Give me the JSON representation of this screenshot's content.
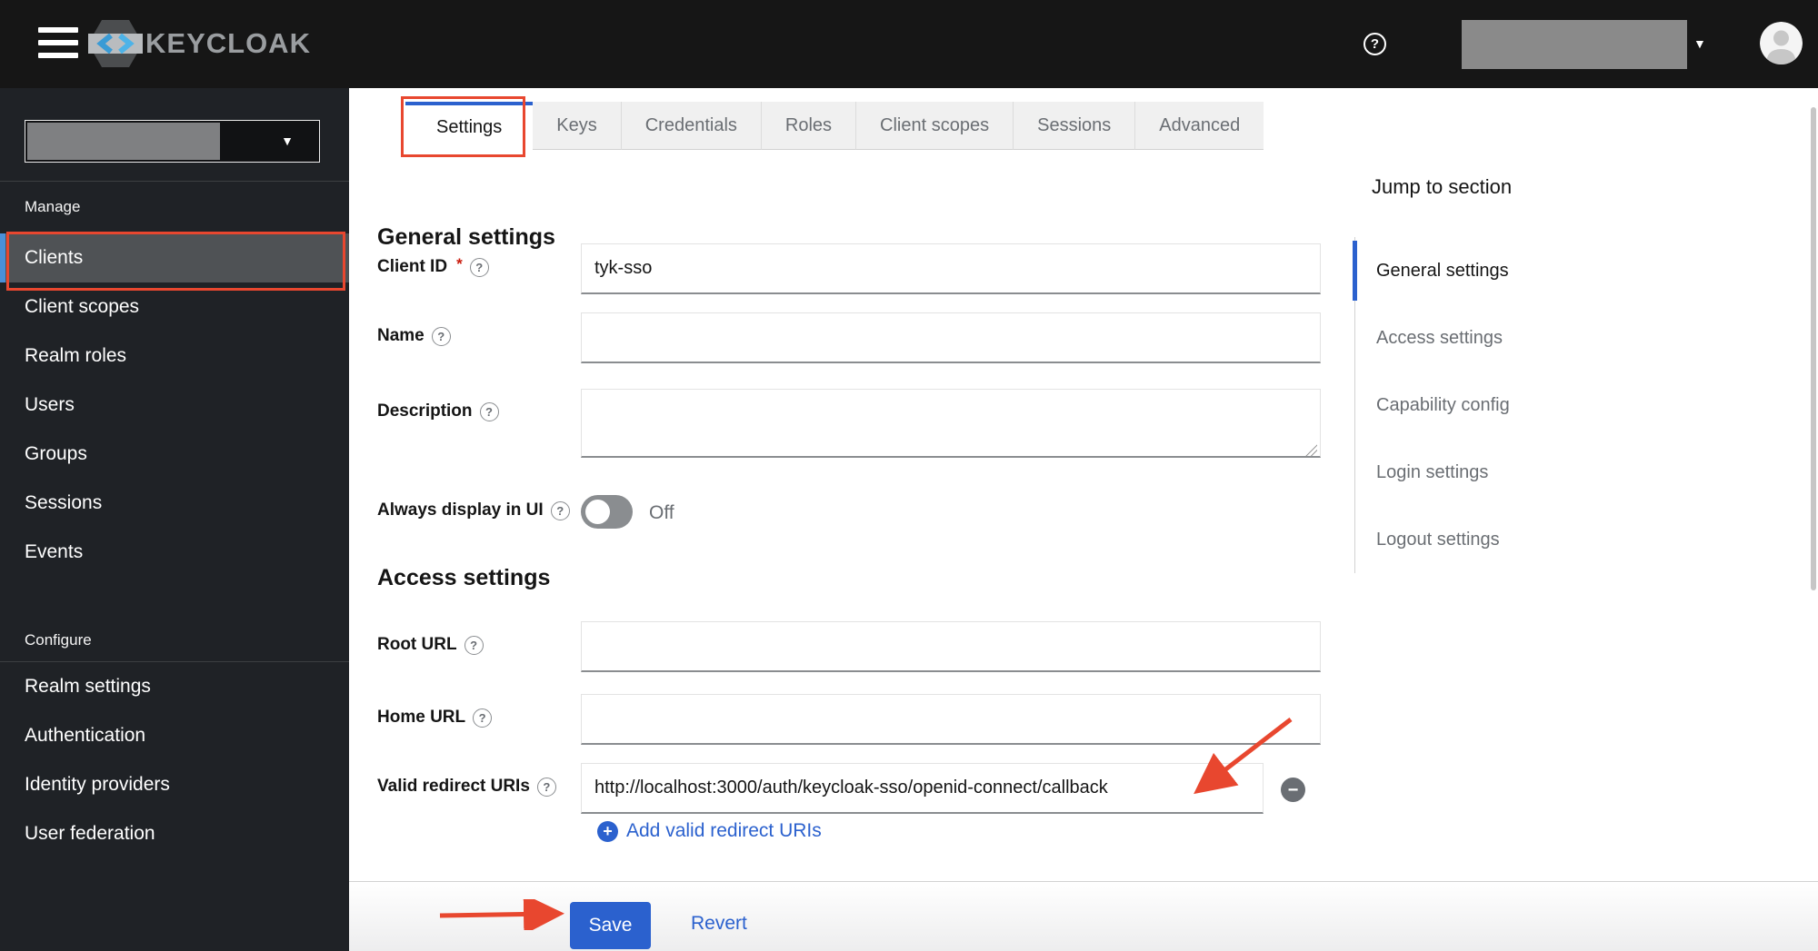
{
  "colors": {
    "accent-blue": "#2b61ce",
    "annotation-red": "#e8472f",
    "topbar-bg": "#161616",
    "sidebar-bg": "#1f2226",
    "sidebar-selected-bg": "#4f5255",
    "sidebar-selected-border": "#4a90d9",
    "muted-text": "#6a6e73",
    "border-gray": "#d2d2d2",
    "input-bottom-border": "#8a8d90",
    "redacted-gray": "#8a8a8a"
  },
  "icons": {
    "help": "?",
    "caret_down": "▼",
    "minus": "−",
    "plus": "+",
    "required_asterisk": "*"
  },
  "topbar": {
    "brand": "KEYCLOAK"
  },
  "sidebar": {
    "sections": [
      {
        "label": "Manage",
        "items": [
          {
            "label": "Clients",
            "selected": true
          },
          {
            "label": "Client scopes"
          },
          {
            "label": "Realm roles"
          },
          {
            "label": "Users"
          },
          {
            "label": "Groups"
          },
          {
            "label": "Sessions"
          },
          {
            "label": "Events"
          }
        ]
      },
      {
        "label": "Configure",
        "items": [
          {
            "label": "Realm settings"
          },
          {
            "label": "Authentication"
          },
          {
            "label": "Identity providers"
          },
          {
            "label": "User federation"
          }
        ]
      }
    ]
  },
  "tabs": {
    "items": [
      {
        "label": "Settings",
        "active": true
      },
      {
        "label": "Keys"
      },
      {
        "label": "Credentials"
      },
      {
        "label": "Roles"
      },
      {
        "label": "Client scopes"
      },
      {
        "label": "Sessions"
      },
      {
        "label": "Advanced"
      }
    ]
  },
  "form": {
    "section_general": "General settings",
    "section_access": "Access settings",
    "client_id": {
      "label": "Client ID",
      "value": "tyk-sso"
    },
    "name": {
      "label": "Name",
      "value": ""
    },
    "description": {
      "label": "Description",
      "value": ""
    },
    "always_display": {
      "label": "Always display in UI",
      "state": "Off"
    },
    "root_url": {
      "label": "Root URL",
      "value": ""
    },
    "home_url": {
      "label": "Home URL",
      "value": ""
    },
    "valid_redirect": {
      "label": "Valid redirect URIs",
      "value": "http://localhost:3000/auth/keycloak-sso/openid-connect/callback"
    },
    "add_redirect_label": "Add valid redirect URIs"
  },
  "jump": {
    "title": "Jump to section",
    "items": [
      {
        "label": "General settings",
        "active": true
      },
      {
        "label": "Access settings"
      },
      {
        "label": "Capability config"
      },
      {
        "label": "Login settings"
      },
      {
        "label": "Logout settings"
      }
    ]
  },
  "footer": {
    "save": "Save",
    "revert": "Revert"
  }
}
